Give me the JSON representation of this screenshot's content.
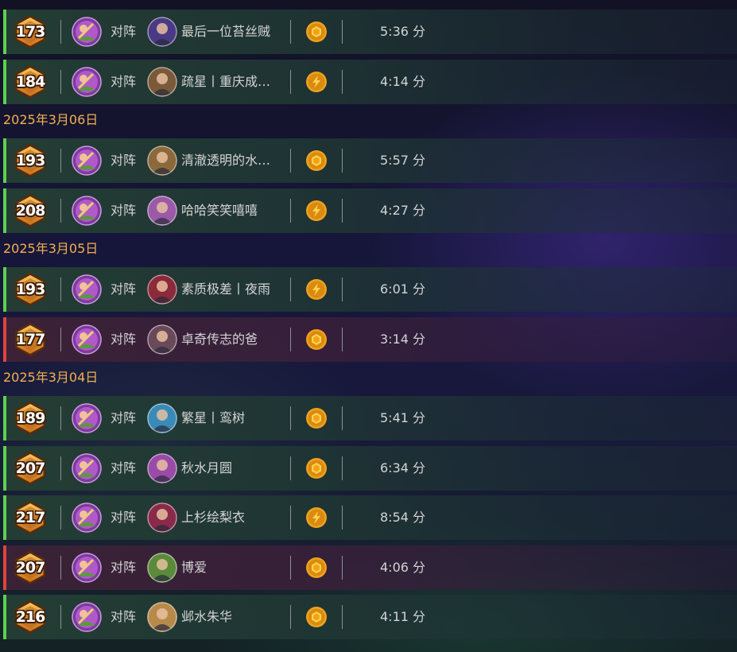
{
  "colors": {
    "win": "#5bd24f",
    "loss": "#e2423c",
    "date": "#f3b14f",
    "text": "#d4d4d4",
    "coin": "#f0a21c"
  },
  "icons": {
    "mode_coin": "coin-icon",
    "mode_bolt": "coin-bolt-icon",
    "hero": "hero-portrait-icon",
    "opponent": "opponent-portrait-icon",
    "rank": "rank-hexagon-icon"
  },
  "matches": [
    {
      "kind": "row",
      "result": "win",
      "rank": "173",
      "vs": "对阵",
      "opponent": "最后一位苔丝贼",
      "mode": "coin",
      "duration": "5:36 分",
      "opp_color": "#4a3a86"
    },
    {
      "kind": "row",
      "result": "win",
      "rank": "184",
      "vs": "对阵",
      "opponent": "疏星丨重庆成…",
      "mode": "bolt",
      "duration": "4:14 分",
      "opp_color": "#7a5a3a"
    },
    {
      "kind": "date",
      "text": "2025年3月06日"
    },
    {
      "kind": "row",
      "result": "win",
      "rank": "193",
      "vs": "对阵",
      "opponent": "清澈透明的水…",
      "mode": "coin",
      "duration": "5:57 分",
      "opp_color": "#8a6a3a"
    },
    {
      "kind": "row",
      "result": "win",
      "rank": "208",
      "vs": "对阵",
      "opponent": "哈哈笑笑嘻嘻",
      "mode": "bolt",
      "duration": "4:27 分",
      "opp_color": "#9a5aa8"
    },
    {
      "kind": "date",
      "text": "2025年3月05日"
    },
    {
      "kind": "row",
      "result": "win",
      "rank": "193",
      "vs": "对阵",
      "opponent": "素质极差丨夜雨",
      "mode": "bolt",
      "duration": "6:01 分",
      "opp_color": "#8a2a3a"
    },
    {
      "kind": "row",
      "result": "loss",
      "rank": "177",
      "vs": "对阵",
      "opponent": "卓奇传志的爸",
      "mode": "coin",
      "duration": "3:14 分",
      "opp_color": "#6a4a5a"
    },
    {
      "kind": "date",
      "text": "2025年3月04日"
    },
    {
      "kind": "row",
      "result": "win",
      "rank": "189",
      "vs": "对阵",
      "opponent": "繁星丨鸾树",
      "mode": "coin",
      "duration": "5:41 分",
      "opp_color": "#3a8ab8"
    },
    {
      "kind": "row",
      "result": "win",
      "rank": "207",
      "vs": "对阵",
      "opponent": "秋水月圆",
      "mode": "coin",
      "duration": "6:34 分",
      "opp_color": "#9a4aa8"
    },
    {
      "kind": "row",
      "result": "win",
      "rank": "217",
      "vs": "对阵",
      "opponent": "上杉绘梨衣",
      "mode": "bolt",
      "duration": "8:54 分",
      "opp_color": "#8a2a4a"
    },
    {
      "kind": "row",
      "result": "loss",
      "rank": "207",
      "vs": "对阵",
      "opponent": "博爱",
      "mode": "coin",
      "duration": "4:06 分",
      "opp_color": "#5a8a3a"
    },
    {
      "kind": "row",
      "result": "win",
      "rank": "216",
      "vs": "对阵",
      "opponent": "邺水朱华",
      "mode": "coin",
      "duration": "4:11 分",
      "opp_color": "#b88a4a"
    }
  ]
}
